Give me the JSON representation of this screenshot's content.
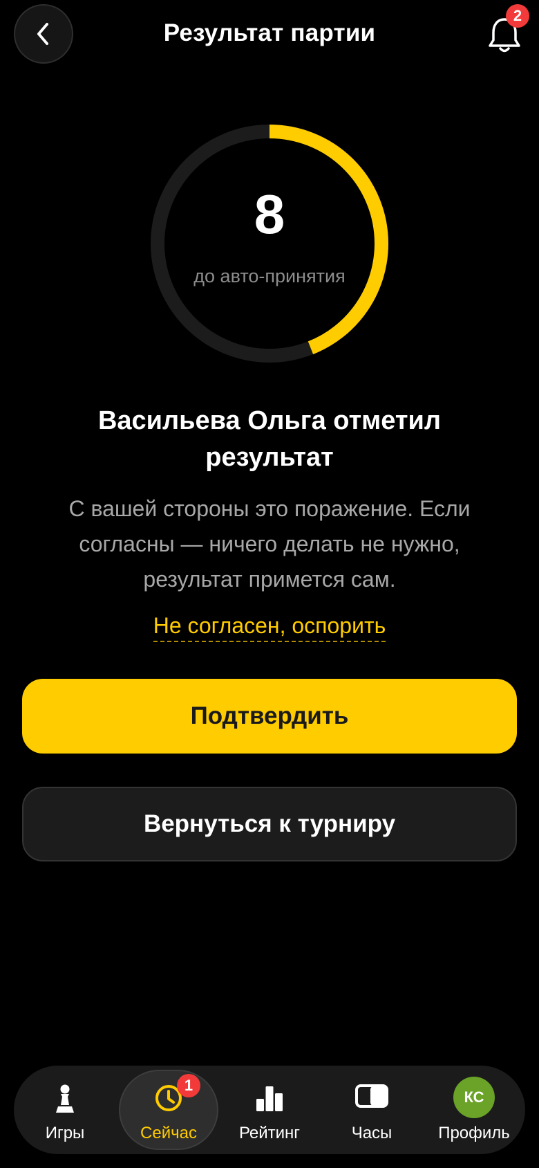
{
  "header": {
    "title": "Результат партии",
    "notification_count": "2"
  },
  "timer": {
    "seconds": "8",
    "caption": "до авто-принятия",
    "progress": 0.44,
    "progress_color": "#ffcc00",
    "track_color": "#1c1c1c"
  },
  "result": {
    "title": "Васильева Ольга отметил результат",
    "description": "С вашей стороны это поражение. Если согласны — ничего делать не нужно, результат примется сам.",
    "dispute_link": "Не согласен, оспорить"
  },
  "actions": {
    "confirm_label": "Подтвердить",
    "back_to_tournament_label": "Вернуться к турниру"
  },
  "tabbar": {
    "items": [
      {
        "label": "Игры",
        "icon": "chess-pawn-icon"
      },
      {
        "label": "Сейчас",
        "icon": "clock-icon",
        "badge": "1",
        "active": true
      },
      {
        "label": "Рейтинг",
        "icon": "bar-chart-icon"
      },
      {
        "label": "Часы",
        "icon": "toggle-clock-icon"
      },
      {
        "label": "Профиль",
        "icon": "avatar",
        "avatar_initials": "КС"
      }
    ]
  },
  "colors": {
    "accent": "#ffcc00",
    "badge": "#f23a3a",
    "avatar": "#6aa327"
  }
}
